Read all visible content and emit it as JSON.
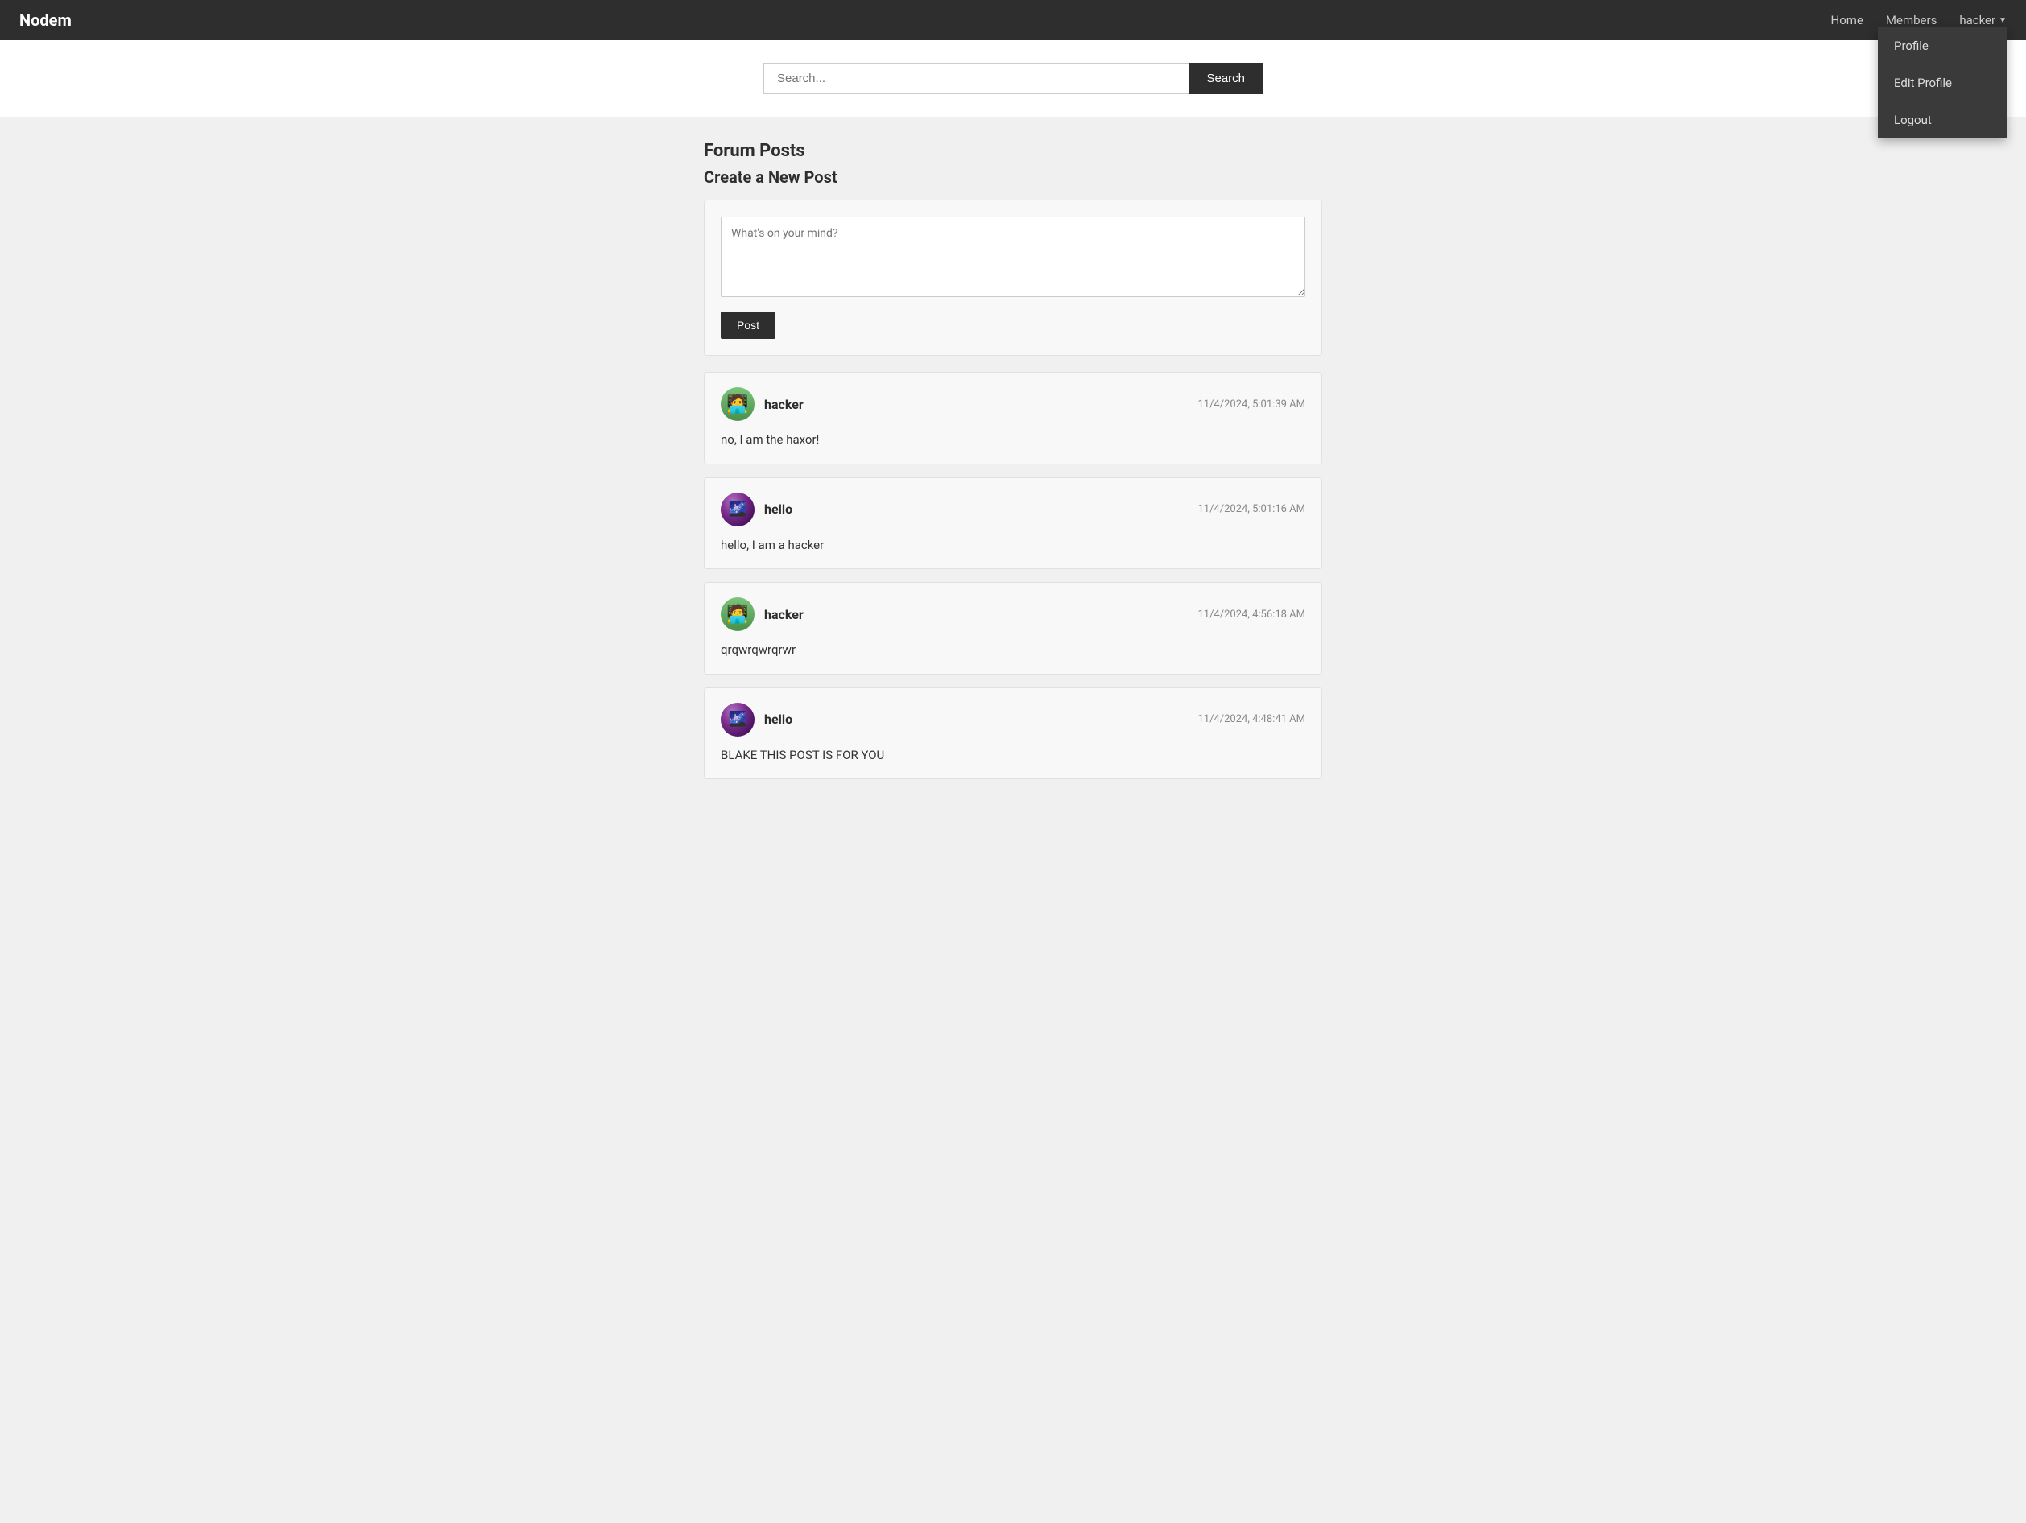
{
  "navbar": {
    "brand": "Nodem",
    "links": [
      {
        "label": "Home",
        "href": "#"
      },
      {
        "label": "Members",
        "href": "#"
      }
    ],
    "user": {
      "name": "hacker",
      "dropdown": [
        {
          "label": "Profile",
          "href": "#"
        },
        {
          "label": "Edit Profile",
          "href": "#"
        },
        {
          "label": "Logout",
          "href": "#"
        }
      ]
    }
  },
  "search": {
    "placeholder": "Search...",
    "button_label": "Search"
  },
  "forum": {
    "title": "Forum Posts",
    "new_post_title": "Create a New Post",
    "textarea_placeholder": "What's on your mind?",
    "post_button_label": "Post"
  },
  "posts": [
    {
      "author": "hacker",
      "avatar_type": "hacker",
      "timestamp": "11/4/2024, 5:01:39 AM",
      "content": "no, I am the haxor!"
    },
    {
      "author": "hello",
      "avatar_type": "hello",
      "timestamp": "11/4/2024, 5:01:16 AM",
      "content": "hello, I am a hacker"
    },
    {
      "author": "hacker",
      "avatar_type": "hacker",
      "timestamp": "11/4/2024, 4:56:18 AM",
      "content": "qrqwrqwrqrwr"
    },
    {
      "author": "hello",
      "avatar_type": "hello",
      "timestamp": "11/4/2024, 4:48:41 AM",
      "content": "BLAKE THIS POST IS FOR YOU"
    }
  ]
}
